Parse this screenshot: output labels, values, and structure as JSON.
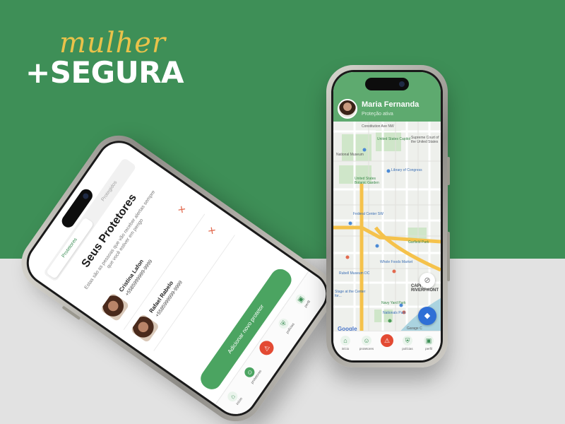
{
  "brand": {
    "script": "mulher",
    "bold": "+SEGURA"
  },
  "map_phone": {
    "user_name": "Maria Fernanda",
    "user_status": "Proteção ativa",
    "map_labels": [
      "Constitution Ave NW",
      "United States Capitol",
      "Supreme Court of the United States",
      "National Museum",
      "Library of Congress",
      "United States Botanic Garden",
      "Federal Center SW",
      "Garfield Park",
      "Rubell Museum DC",
      "Whole Foods Market",
      "Stage at the Center for...",
      "Navy Yard Park",
      "CAPITOL RIVERFRONT",
      "Garage C",
      "Nationals Park",
      "SE",
      "SW",
      "I St SE",
      "M St SE"
    ],
    "google_label": "Google",
    "tabs": [
      {
        "label": "início",
        "icon": "home-icon"
      },
      {
        "label": "protetores",
        "icon": "people-icon"
      },
      {
        "label": "",
        "icon": "sos-icon"
      },
      {
        "label": "polícias",
        "icon": "shield-icon"
      },
      {
        "label": "perfil",
        "icon": "profile-icon"
      }
    ]
  },
  "protectors_phone": {
    "tab_active": "Protetores",
    "tab_inactive": "Protegidos",
    "title": "Seus Protetores",
    "subtitle": "Estas são as pessoas que vão receber alertas sempre que você estiver em perigo",
    "contacts": [
      {
        "name": "Cristina Lafon",
        "phone": "+5585999999-9999"
      },
      {
        "name": "Rafael Rabelo",
        "phone": "+5585999999-9999"
      }
    ],
    "add_button": "Adicionar novo protetor",
    "tabs": [
      {
        "label": "início",
        "icon": "home-icon"
      },
      {
        "label": "protetores",
        "icon": "people-icon"
      },
      {
        "label": "",
        "icon": "sos-icon"
      },
      {
        "label": "polícias",
        "icon": "shield-icon"
      },
      {
        "label": "perfil",
        "icon": "profile-icon"
      }
    ]
  },
  "colors": {
    "brand_green": "#3e8f57",
    "header_green": "#5eaa6f",
    "button_green": "#4ba461",
    "sos_red": "#e34a33",
    "accent_yellow": "#e9c24a"
  }
}
